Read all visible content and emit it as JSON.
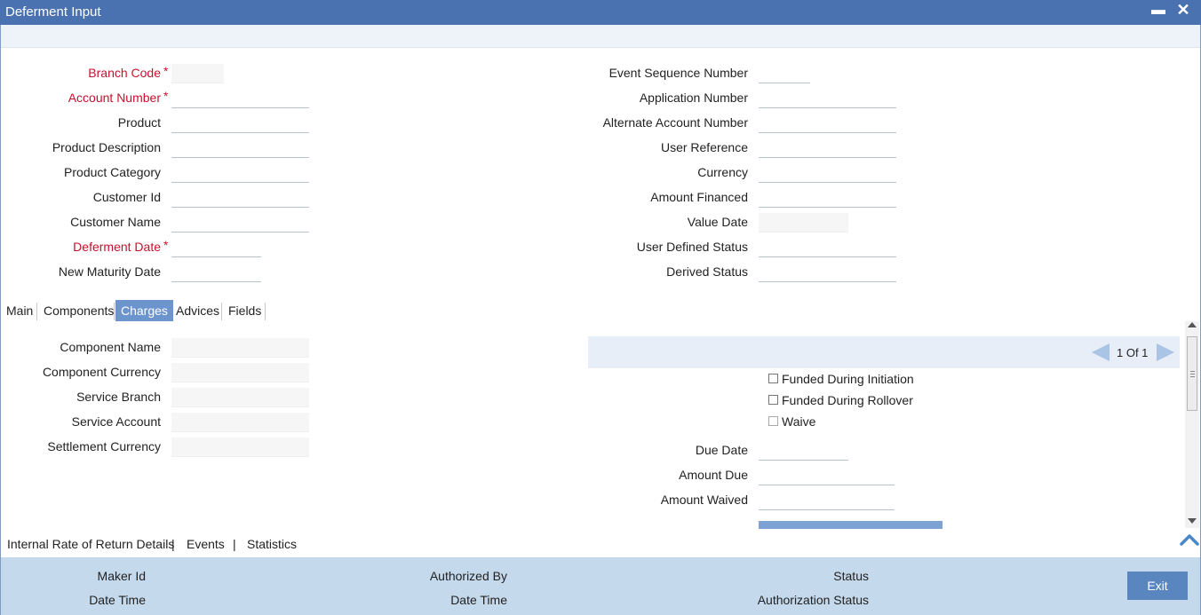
{
  "window": {
    "title": "Deferment Input",
    "minimize_glyph": "▬",
    "close_glyph": "✕"
  },
  "header_left": {
    "branch_code": "Branch Code",
    "account_number": "Account Number",
    "product": "Product",
    "product_description": "Product Description",
    "product_category": "Product Category",
    "customer_id": "Customer Id",
    "customer_name": "Customer Name",
    "deferment_date": "Deferment Date",
    "new_maturity_date": "New Maturity Date",
    "required_marker": "*"
  },
  "header_right": {
    "event_sequence_number": "Event Sequence Number",
    "application_number": "Application Number",
    "alternate_account_number": "Alternate Account Number",
    "user_reference": "User Reference",
    "currency": "Currency",
    "amount_financed": "Amount Financed",
    "value_date": "Value Date",
    "user_defined_status": "User Defined Status",
    "derived_status": "Derived Status"
  },
  "tabs": [
    {
      "label": "Main"
    },
    {
      "label": "Components"
    },
    {
      "label": "Charges",
      "active": true
    },
    {
      "label": "Advices"
    },
    {
      "label": "Fields"
    }
  ],
  "charges": {
    "component_name": "Component Name",
    "component_currency": "Component Currency",
    "service_branch": "Service Branch",
    "service_account": "Service Account",
    "settlement_currency": "Settlement Currency",
    "paging": "1 Of 1",
    "funded_during_initiation": "Funded During Initiation",
    "funded_during_rollover": "Funded During Rollover",
    "waive": "Waive",
    "due_date": "Due Date",
    "amount_due": "Amount Due",
    "amount_waived": "Amount Waived"
  },
  "footer_links": {
    "irr_details": "Internal Rate of Return Details",
    "events": "Events",
    "statistics": "Statistics",
    "separator": "|"
  },
  "audit": {
    "maker_id": "Maker Id",
    "maker_date_time": "Date Time",
    "authorized_by": "Authorized By",
    "checker_date_time": "Date Time",
    "status": "Status",
    "authorization_status": "Authorization Status",
    "exit": "Exit"
  },
  "colors": {
    "titlebar": "#4a72b0",
    "required": "#c8102e",
    "active_tab": "#6d95cd",
    "audit_bg": "#c5d9ec",
    "exit_button": "#5a86c0"
  }
}
